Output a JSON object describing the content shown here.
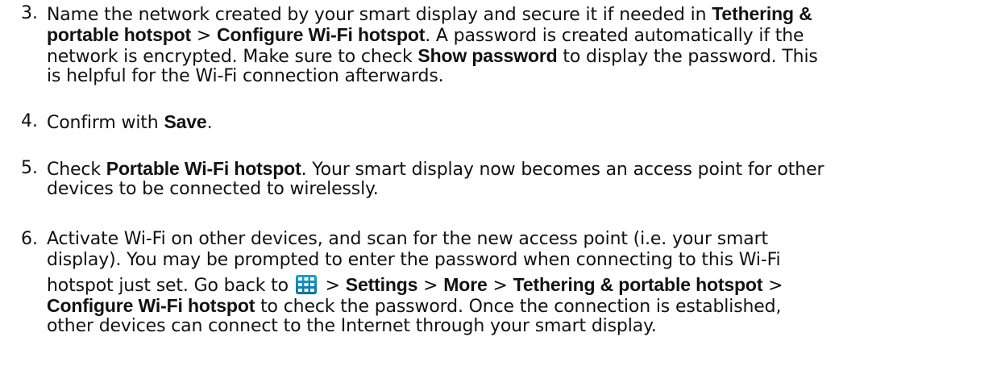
{
  "steps": [
    {
      "number": "3.",
      "lines": [
        [
          {
            "t": "Name the network created by your smart display and secure it if needed in "
          },
          {
            "b": "Tethering &"
          }
        ],
        [
          {
            "b": "portable hotspot"
          },
          {
            "t": " > "
          },
          {
            "b": "Configure Wi-Fi hotspot"
          },
          {
            "t": ". A password is created automatically if the"
          }
        ],
        [
          {
            "t": "network is encrypted. Make sure to check "
          },
          {
            "b": "Show password"
          },
          {
            "t": " to display the password. This"
          }
        ],
        [
          {
            "t": "is helpful for the Wi-Fi connection afterwards."
          }
        ]
      ]
    },
    {
      "number": "4.",
      "lines": [
        [
          {
            "t": "Confirm with "
          },
          {
            "b": "Save"
          },
          {
            "t": "."
          }
        ]
      ]
    },
    {
      "number": "5.",
      "lines": [
        [
          {
            "t": "Check "
          },
          {
            "b": "Portable Wi-Fi hotspot"
          },
          {
            "t": ". Your smart display now becomes an access point for other"
          }
        ],
        [
          {
            "t": "devices to be connected to wirelessly."
          }
        ]
      ]
    },
    {
      "number": "6.",
      "lines": [
        [
          {
            "t": "Activate Wi-Fi on other devices, and scan for the new access point (i.e. your smart"
          }
        ],
        [
          {
            "t": "display). You may be prompted to enter the password when connecting to this Wi-Fi"
          }
        ],
        [
          {
            "t": "hotspot just set. Go back to "
          },
          {
            "icon": "apps-grid-icon"
          },
          {
            "t": " > "
          },
          {
            "b": "Settings"
          },
          {
            "t": " > "
          },
          {
            "b": "More"
          },
          {
            "t": " > "
          },
          {
            "b": "Tethering & portable hotspot"
          },
          {
            "t": " >"
          }
        ],
        [
          {
            "b": "Configure Wi-Fi hotspot"
          },
          {
            "t": " to check the password. Once the connection is established,"
          }
        ],
        [
          {
            "t": "other devices can connect to the Internet through your smart display."
          }
        ]
      ]
    }
  ]
}
